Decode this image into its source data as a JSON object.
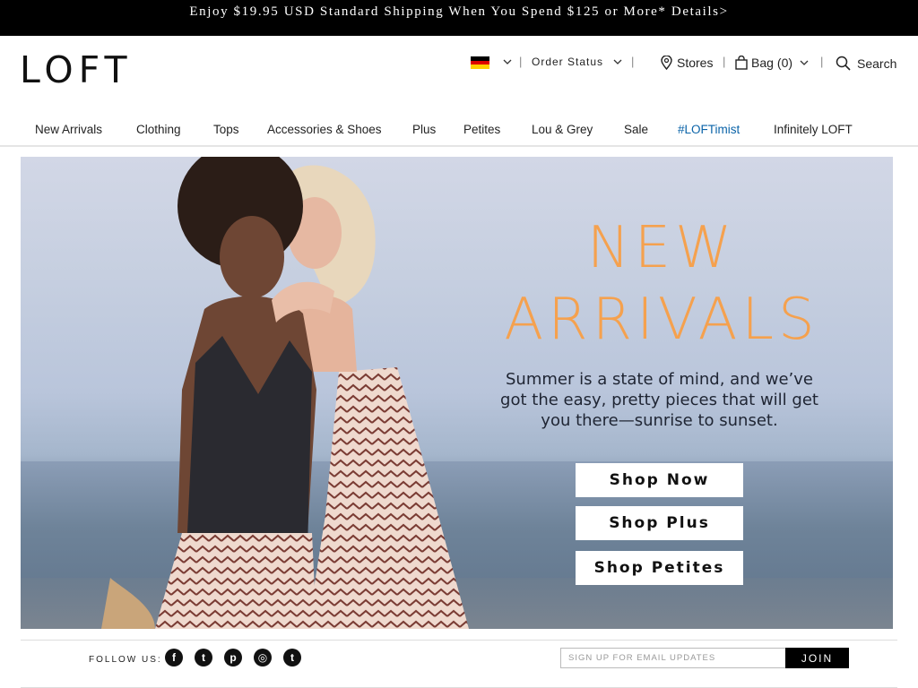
{
  "promo": {
    "text": "Enjoy $19.95 USD Standard Shipping When You Spend $125 or More* Details>"
  },
  "brand": {
    "logo": "LOFT"
  },
  "utility": {
    "country": "Germany",
    "order_status": "Order Status",
    "sep": "|",
    "stores": "Stores",
    "bag_label": "Bag",
    "bag_count": "(0)",
    "search": "Search"
  },
  "nav": {
    "items": [
      "New Arrivals",
      "Clothing",
      "Tops",
      "Accessories & Shoes",
      "Plus",
      "Petites",
      "Lou & Grey",
      "Sale",
      "#LOFTimist",
      "Infinitely LOFT"
    ]
  },
  "hero": {
    "headline_1": "NEW",
    "headline_2": "ARRIVALS",
    "copy_1": "Summer is a state of mind, and we’ve",
    "copy_2": "got the easy, pretty pieces that will get",
    "copy_3": "you there—sunrise to sunset.",
    "ctas": [
      "Shop Now",
      "Shop Plus",
      "Shop Petites"
    ]
  },
  "footer": {
    "follow_label": "FOLLOW US:",
    "social": [
      "facebook-icon",
      "twitter-icon",
      "pinterest-icon",
      "instagram-icon",
      "tumblr-icon"
    ],
    "email_placeholder": "SIGN UP FOR EMAIL UPDATES",
    "join_label": "JOIN"
  },
  "colors": {
    "accent_nav": "#0a63a8",
    "headline": "#f5a14e",
    "promo_bg": "#000000"
  }
}
